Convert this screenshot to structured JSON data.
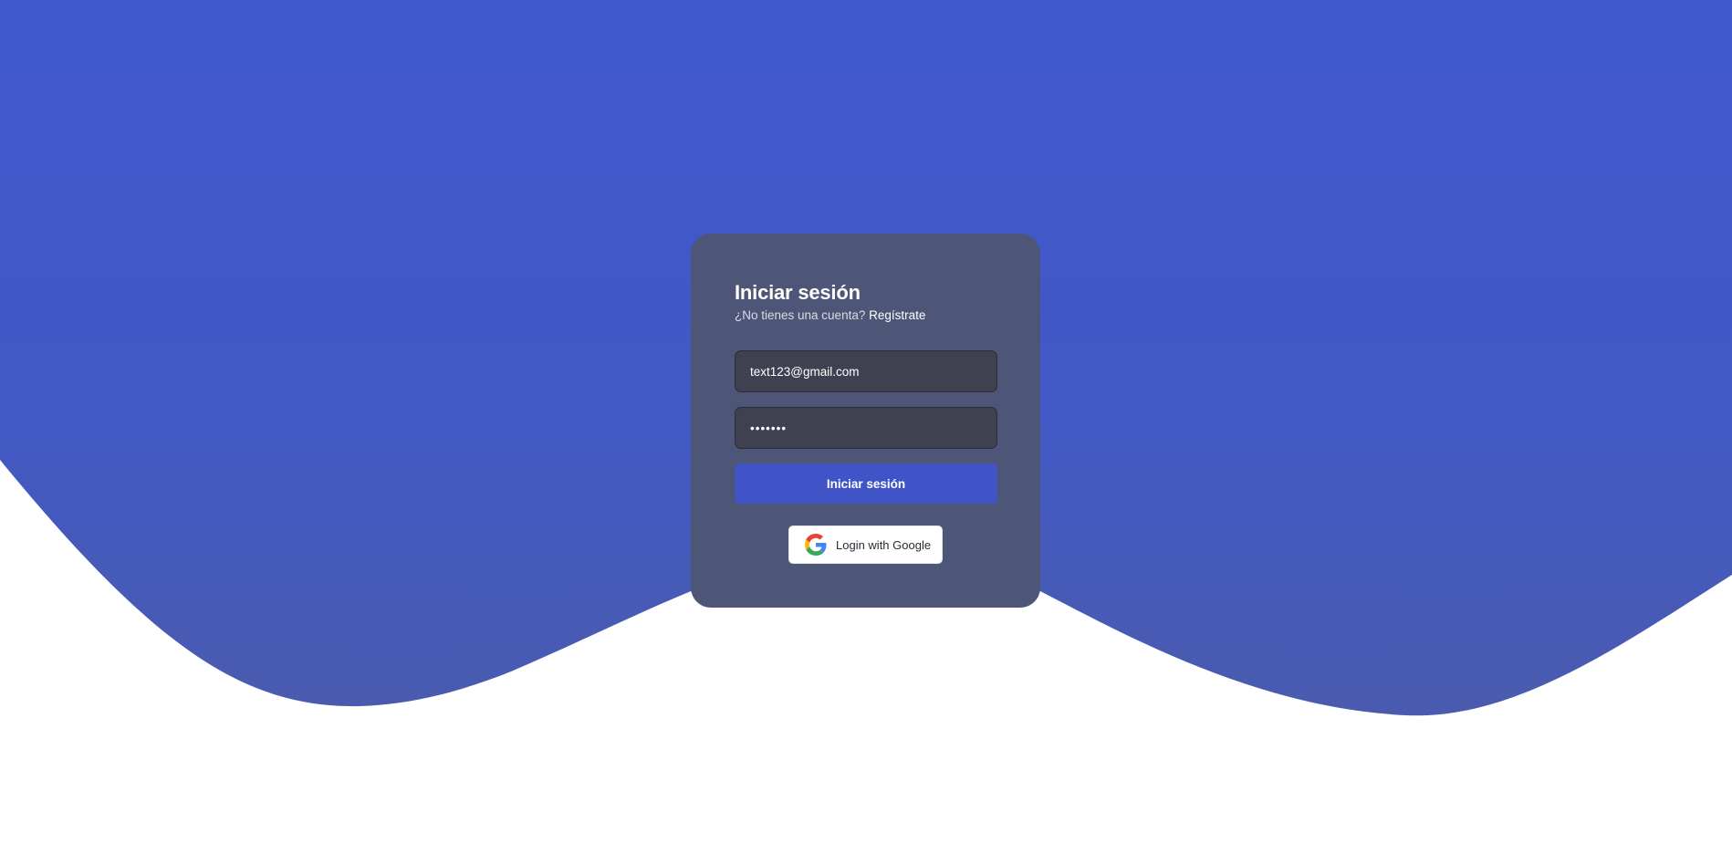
{
  "theme": {
    "background": "#ffffff",
    "wave_color": "#4058c8",
    "card_color": "#4d5677",
    "input_color": "#3f4150",
    "accent": "#4054c8"
  },
  "login": {
    "title": "Iniciar sesión",
    "subtitle_text": "¿No tienes una cuenta?",
    "register_link": "Regístrate",
    "email_value": "text123@gmail.com",
    "password_display": "•••••••",
    "submit_label": "Iniciar sesión",
    "google_label": "Login with Google",
    "google_icon": "google-icon"
  }
}
